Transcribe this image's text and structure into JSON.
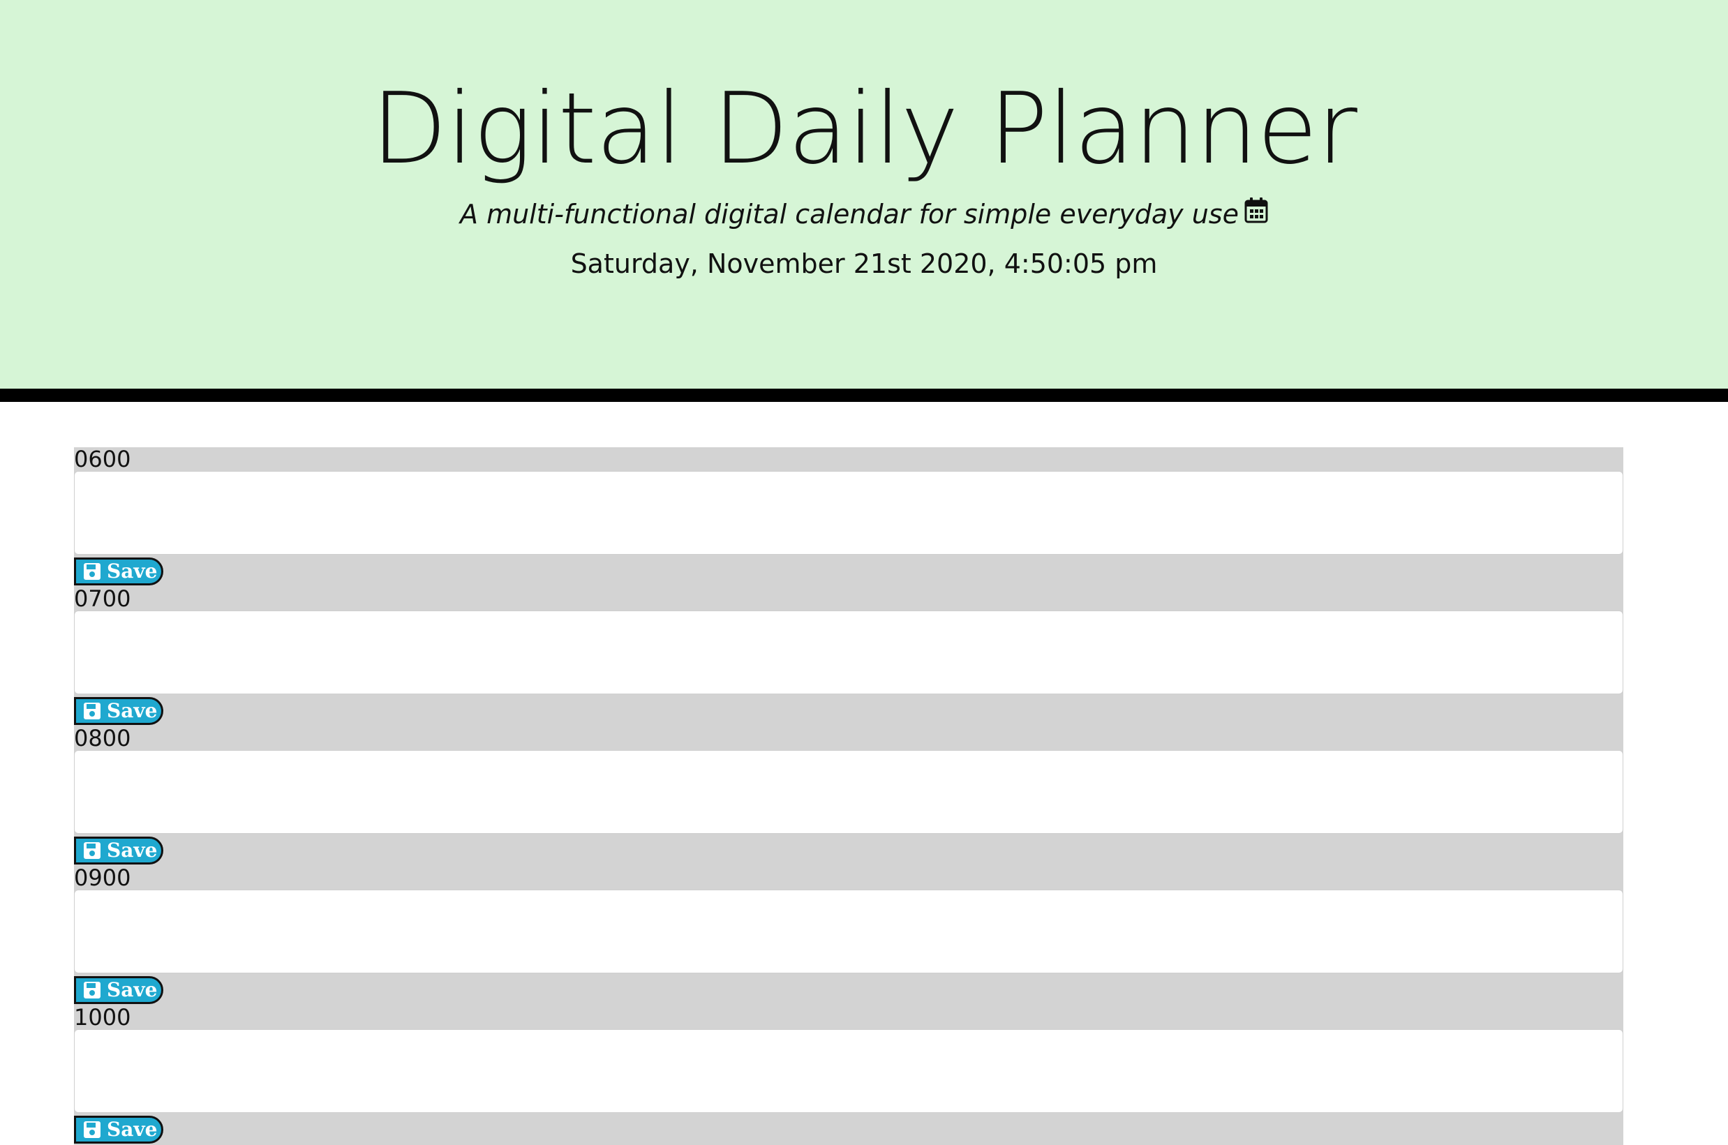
{
  "header": {
    "title": "Digital Daily Planner",
    "subtitle": "A multi-functional digital calendar for simple everyday use",
    "subtitle_icon": "calendar-icon",
    "datetime": "Saturday, November 21st 2020, 4:50:05 pm"
  },
  "colors": {
    "header_background": "#d6f5d6",
    "header_border": "#000000",
    "block_background": "#d3d3d3",
    "save_button": "#1fa8cf"
  },
  "planner": {
    "save_label": "Save",
    "save_icon": "floppy-disk-icon",
    "hours": [
      {
        "label": "0600",
        "text": ""
      },
      {
        "label": "0700",
        "text": ""
      },
      {
        "label": "0800",
        "text": ""
      },
      {
        "label": "0900",
        "text": ""
      },
      {
        "label": "1000",
        "text": ""
      }
    ]
  }
}
